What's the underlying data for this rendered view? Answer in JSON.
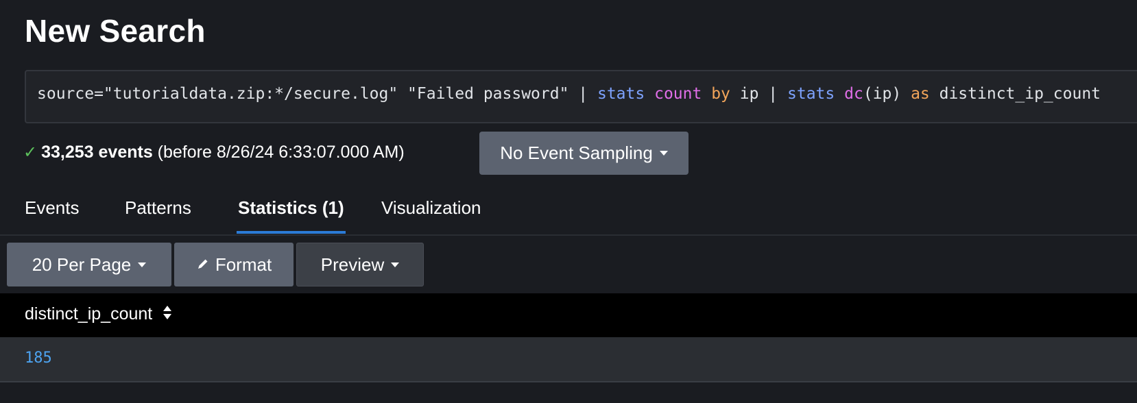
{
  "page": {
    "title": "New Search"
  },
  "search": {
    "query_parts": {
      "p1": "source=\"tutorialdata.zip:*/secure.log\" \"Failed password\" | ",
      "p2": "stats",
      "p3": " ",
      "p4": "count",
      "p5": " ",
      "p6": "by",
      "p7": " ip | ",
      "p8": "stats",
      "p9": " ",
      "p10": "dc",
      "p11": "(ip) ",
      "p12": "as",
      "p13": " distinct_ip_count"
    }
  },
  "status": {
    "check_icon": "✓",
    "events_count": "33,253 events",
    "before_text": " (before 8/26/24 6:33:07.000 AM)"
  },
  "sampling": {
    "label": "No Event Sampling"
  },
  "tabs": [
    {
      "label": "Events",
      "active": false
    },
    {
      "label": "Patterns",
      "active": false
    },
    {
      "label": "Statistics (1)",
      "active": true
    },
    {
      "label": "Visualization",
      "active": false
    }
  ],
  "toolbar": {
    "per_page_label": "20 Per Page",
    "format_label": "Format",
    "preview_label": "Preview"
  },
  "table": {
    "columns": [
      "distinct_ip_count"
    ],
    "rows": [
      [
        "185"
      ]
    ]
  },
  "icons": {
    "check": "check-icon",
    "caret": "caret-down-icon",
    "pencil": "pencil-icon",
    "sort": "sort-icon"
  },
  "colors": {
    "background": "#1a1c21",
    "accent_tab": "#2b7bd6",
    "check": "#5cc05c",
    "command": "#7ea3ff",
    "function": "#e06ee8",
    "keyword": "#f2a55a",
    "value_link": "#4da3f0"
  }
}
